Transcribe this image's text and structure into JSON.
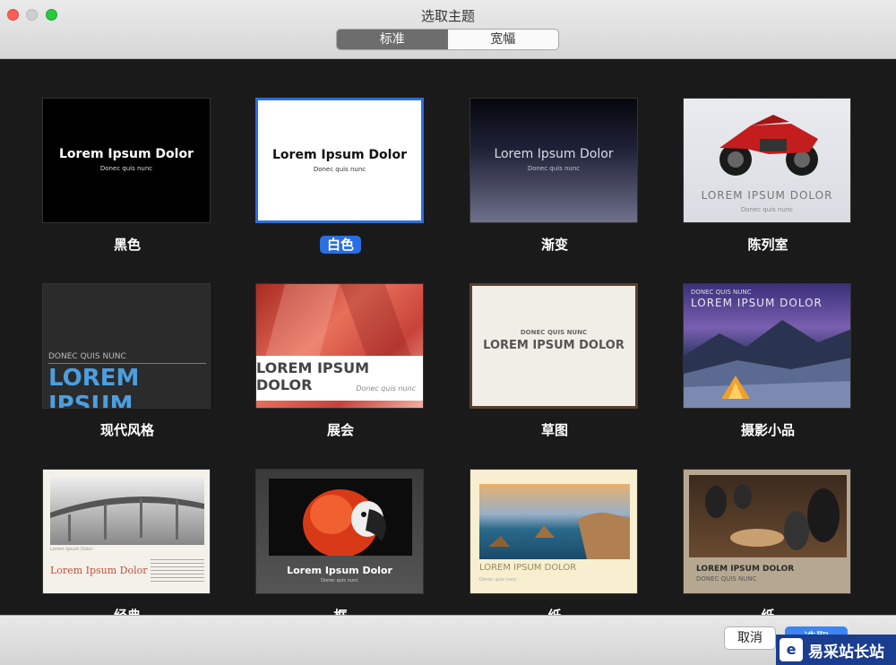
{
  "window": {
    "title": "选取主题"
  },
  "segmented": {
    "standard": "标准",
    "wide": "宽幅"
  },
  "themes": [
    {
      "name": "黑色",
      "title": "Lorem Ipsum Dolor",
      "subtitle": "Donec quis nunc"
    },
    {
      "name": "白色",
      "title": "Lorem Ipsum Dolor",
      "subtitle": "Donec quis nunc",
      "selected": true
    },
    {
      "name": "渐变",
      "title": "Lorem Ipsum Dolor",
      "subtitle": "Donec quis nunc"
    },
    {
      "name": "陈列室",
      "title": "LOREM IPSUM DOLOR",
      "subtitle": "Donec quis nunc"
    },
    {
      "name": "现代风格",
      "title": "LOREM IPSUM",
      "subtitle": "DONEC QUIS NUNC"
    },
    {
      "name": "展会",
      "title": "LOREM IPSUM DOLOR",
      "subtitle": "Donec quis nunc"
    },
    {
      "name": "草图",
      "title": "LOREM IPSUM DOLOR",
      "subtitle": "DONEC QUIS NUNC"
    },
    {
      "name": "摄影小品",
      "title": "LOREM IPSUM DOLOR",
      "subtitle": "DONEC QUIS NUNC"
    },
    {
      "name": "经典",
      "title": "Lorem Ipsum Dolor",
      "subtitle": "Lorem Ipsum Dolor"
    },
    {
      "name": "框",
      "title": "Lorem Ipsum Dolor",
      "subtitle": "Donec quis nunc"
    },
    {
      "name": "纸",
      "title": "LOREM IPSUM DOLOR",
      "subtitle": "Donec quis nunc"
    },
    {
      "name": "纸",
      "title": "LOREM IPSUM DOLOR",
      "subtitle": "DONEC QUIS NUNC"
    }
  ],
  "buttons": {
    "cancel": "取消",
    "choose": "选取"
  },
  "watermark": {
    "text": "易采站长站",
    "logo": "e"
  },
  "colors": {
    "selection": "#2a6ee0",
    "accent_blue": "#3d85f0"
  }
}
